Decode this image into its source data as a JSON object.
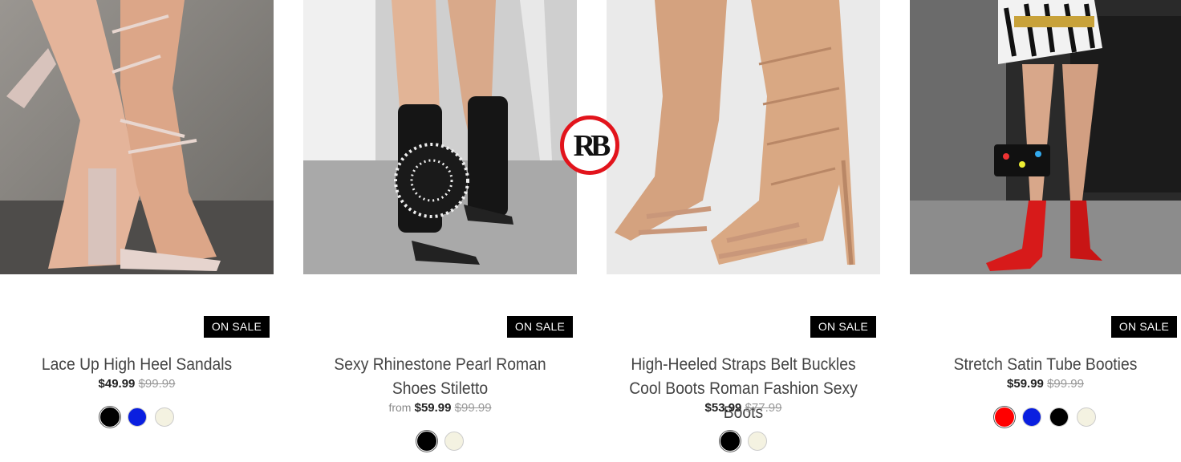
{
  "products": [
    {
      "title": "Lace Up High Heel Sandals",
      "badge": "ON SALE",
      "from_label": "",
      "price": "$49.99",
      "compare_price": "$99.99",
      "swatches": [
        "#000000",
        "#0a1fe0",
        "#f4f2e1"
      ],
      "selected_swatch": 0,
      "image_icon": "lace-up-sandal-photo"
    },
    {
      "title": "Sexy Rhinestone Pearl Roman Shoes Stiletto",
      "badge": "ON SALE",
      "from_label": "from",
      "price": "$59.99",
      "compare_price": "$99.99",
      "swatches": [
        "#000000",
        "#f4f2e1"
      ],
      "selected_swatch": 0,
      "image_icon": "rhinestone-sandal-photo"
    },
    {
      "title": "High-Heeled Straps Belt Buckles Cool Boots Roman Fashion Sexy Boots",
      "badge": "ON SALE",
      "from_label": "",
      "price": "$53.99",
      "compare_price": "$77.99",
      "swatches": [
        "#000000",
        "#f4f2e1"
      ],
      "selected_swatch": 0,
      "image_icon": "nude-strap-boot-photo"
    },
    {
      "title": "Stretch Satin Tube Booties",
      "badge": "ON SALE",
      "from_label": "",
      "price": "$59.99",
      "compare_price": "$99.99",
      "swatches": [
        "#ff0000",
        "#0a1fe0",
        "#000000",
        "#f4f2e1"
      ],
      "selected_swatch": 0,
      "image_icon": "red-sock-bootie-photo"
    }
  ],
  "logo": {
    "text": "RB",
    "ring_color": "#e2141c"
  },
  "colors": {
    "badge_bg": "#000000",
    "badge_fg": "#ffffff"
  }
}
